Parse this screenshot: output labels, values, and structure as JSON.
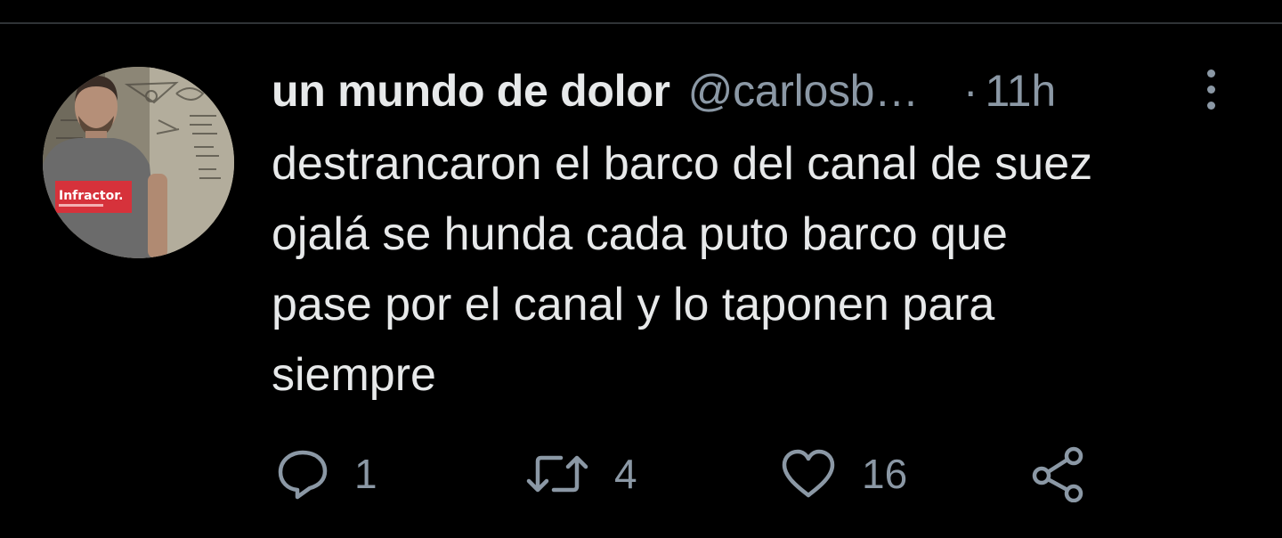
{
  "theme": {
    "background": "#000000",
    "text_primary": "#e7e9ea",
    "text_secondary": "#8b98a5",
    "divider": "#2f3336"
  },
  "tweet": {
    "author": {
      "display_name": "un mundo de dolor",
      "handle": "@carlosb…",
      "avatar_icon": "user-photo",
      "shirt_text": "Infractor."
    },
    "separator": "·",
    "time": "11h",
    "text_lines": [
      "destrancaron el barco del canal de suez",
      "ojalá se hunda cada puto barco que",
      "pase por el canal y lo taponen para",
      "siempre"
    ],
    "actions": {
      "reply": {
        "icon": "reply-icon",
        "count": "1"
      },
      "retweet": {
        "icon": "retweet-icon",
        "count": "4"
      },
      "like": {
        "icon": "heart-icon",
        "count": "16"
      },
      "share": {
        "icon": "share-icon"
      }
    },
    "more_icon": "more-vertical-icon"
  }
}
